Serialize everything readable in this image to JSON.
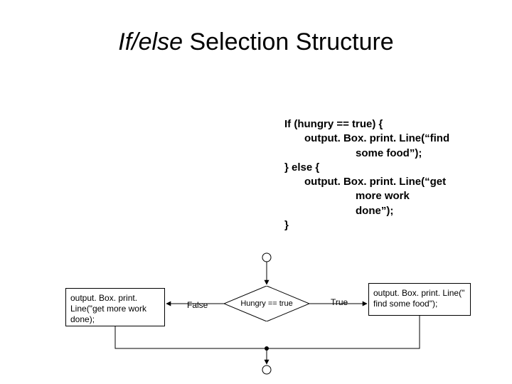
{
  "title_italic": "If/else",
  "title_rest": " Selection Structure",
  "code": {
    "l1": "If (hungry == true) {",
    "l2": "output. Box. print. Line(“find",
    "l3": "some food”);",
    "l4": "} else {",
    "l5": "output. Box. print. Line(“get",
    "l6": "more work",
    "l7": "done”);",
    "l8": "}"
  },
  "diagram": {
    "decision": "Hungry == true",
    "false_label": "False",
    "true_label": "True",
    "left_box": "output. Box. print. Line(\"get more work done);",
    "right_box": "output. Box. print. Line(\" find some food\");"
  }
}
